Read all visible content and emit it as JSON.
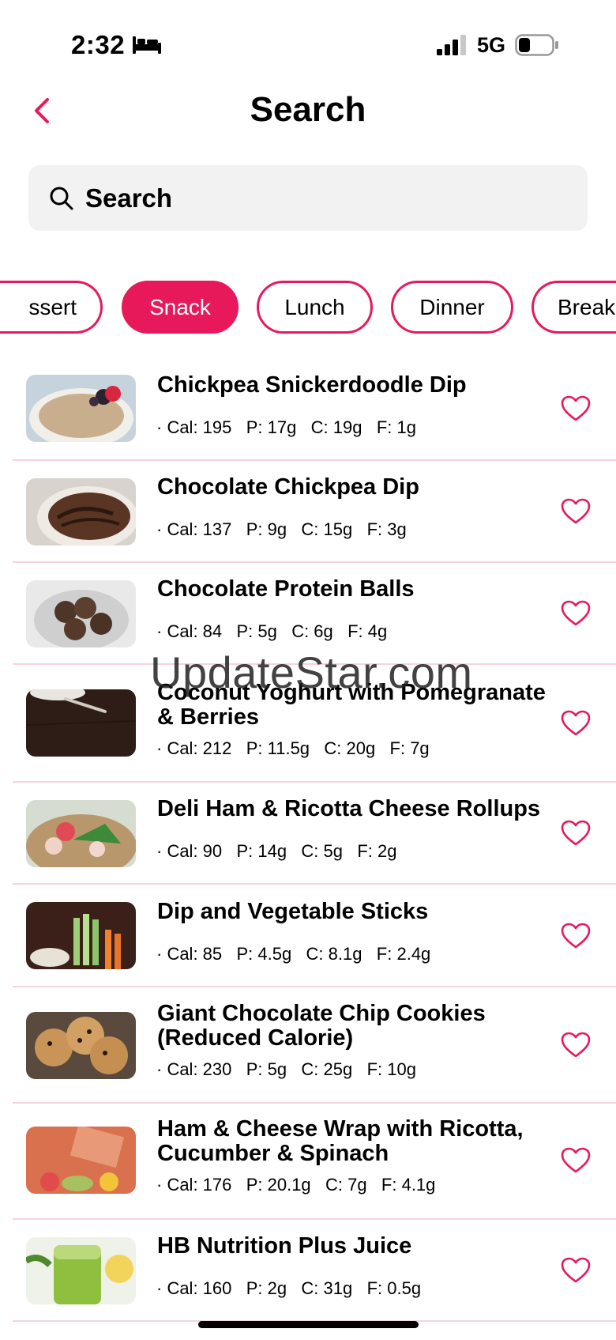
{
  "status": {
    "time": "2:32",
    "network": "5G"
  },
  "header": {
    "title": "Search"
  },
  "search": {
    "placeholder": "Search"
  },
  "categories": [
    {
      "label": "ssert",
      "active": false
    },
    {
      "label": "Snack",
      "active": true
    },
    {
      "label": "Lunch",
      "active": false
    },
    {
      "label": "Dinner",
      "active": false
    },
    {
      "label": "Break",
      "active": false
    }
  ],
  "recipes": [
    {
      "name": "Chickpea Snickerdoodle Dip",
      "macros": "· Cal: 195   P: 17g   C: 19g   F: 1g",
      "image": "oat-bowl-with-berries"
    },
    {
      "name": "Chocolate Chickpea Dip",
      "macros": "· Cal: 137   P: 9g   C: 15g   F: 3g",
      "image": "chocolate-dip-bowl"
    },
    {
      "name": "Chocolate Protein Balls",
      "macros": "· Cal: 84   P: 5g   C: 6g   F: 4g",
      "image": "protein-balls-bowl"
    },
    {
      "name": "Coconut Yoghurt with Pomegranate & Berries",
      "macros": "· Cal: 212   P: 11.5g   C: 20g   F: 7g",
      "image": "dark-wood-spoon"
    },
    {
      "name": "Deli Ham & Ricotta Cheese Rollups",
      "macros": "· Cal: 90   P: 14g   C: 5g   F: 2g",
      "image": "ham-rollups-plate"
    },
    {
      "name": "Dip and Vegetable Sticks",
      "macros": "· Cal: 85   P: 4.5g   C: 8.1g   F: 2.4g",
      "image": "vegetable-sticks"
    },
    {
      "name": "Giant Chocolate Chip Cookies (Reduced Calorie)",
      "macros": "· Cal: 230   P: 5g   C: 25g   F: 10g",
      "image": "chocolate-chip-cookies"
    },
    {
      "name": "Ham & Cheese Wrap with Ricotta, Cucumber & Spinach",
      "macros": "· Cal: 176   P: 20.1g   C: 7g   F: 4.1g",
      "image": "wrap-on-orange-table"
    },
    {
      "name": "HB Nutrition Plus Juice",
      "macros": "· Cal: 160   P: 2g   C: 31g   F: 0.5g",
      "image": "green-juice-glass"
    }
  ],
  "watermark": "UpdateStar.com",
  "colors": {
    "accent": "#e8195a",
    "divider": "#f6d3de",
    "search_bg": "#f2f2f2"
  }
}
